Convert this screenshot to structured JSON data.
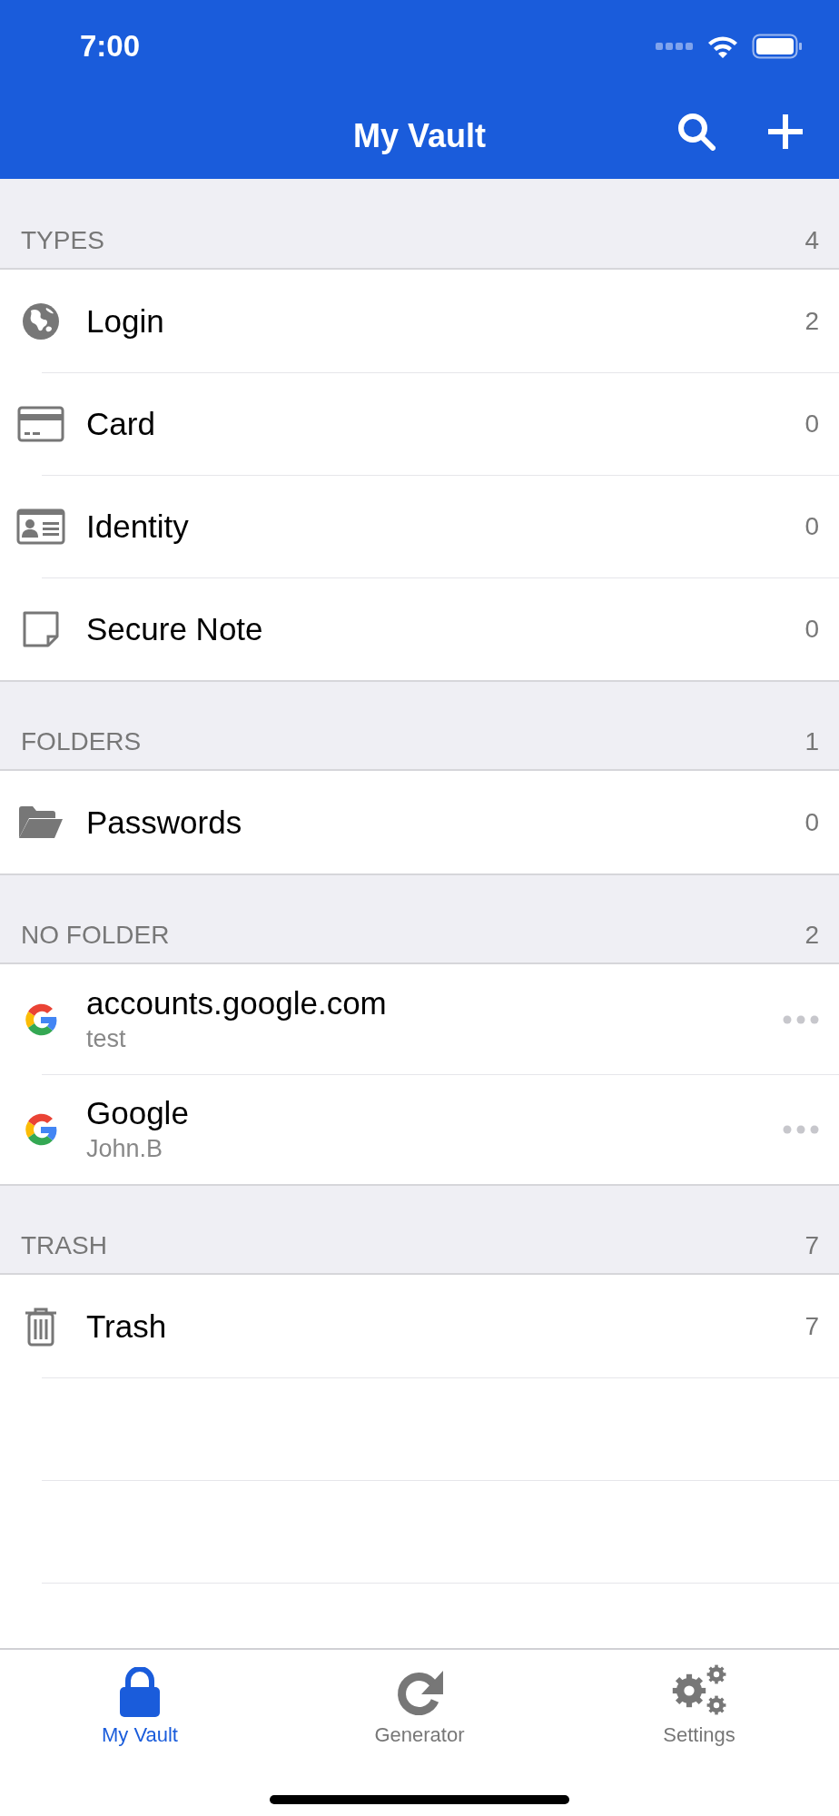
{
  "status_bar": {
    "time": "7:00"
  },
  "nav_bar": {
    "title": "My Vault"
  },
  "sections": [
    {
      "title": "TYPES",
      "count": "4",
      "items": [
        {
          "kind": "globe",
          "label": "Login",
          "count": "2"
        },
        {
          "kind": "card",
          "label": "Card",
          "count": "0"
        },
        {
          "kind": "identity",
          "label": "Identity",
          "count": "0"
        },
        {
          "kind": "note",
          "label": "Secure Note",
          "count": "0"
        }
      ]
    },
    {
      "title": "FOLDERS",
      "count": "1",
      "items": [
        {
          "kind": "folder",
          "label": "Passwords",
          "count": "0"
        }
      ]
    },
    {
      "title": "NO FOLDER",
      "count": "2",
      "items": [
        {
          "kind": "login",
          "label": "accounts.google.com",
          "subtitle": "test"
        },
        {
          "kind": "login",
          "label": "Google",
          "subtitle": "John.B"
        }
      ]
    },
    {
      "title": "TRASH",
      "count": "7",
      "items": [
        {
          "kind": "trash",
          "label": "Trash",
          "count": "7"
        }
      ]
    }
  ],
  "tabs": [
    {
      "kind": "vault",
      "label": "My Vault",
      "selected": true
    },
    {
      "kind": "generator",
      "label": "Generator",
      "selected": false
    },
    {
      "kind": "settings",
      "label": "Settings",
      "selected": false
    }
  ]
}
